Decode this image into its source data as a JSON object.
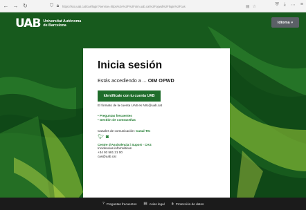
{
  "browser": {
    "back_icon": "arrow-left-icon",
    "forward_icon": "arrow-right-icon",
    "reload_icon": "reload-icon",
    "url": "https://sso.uab.cat/cas/login?service=https%3A%2F%2Foim.uab.cat%2Fopwd%2Flogin%2Fcas"
  },
  "header": {
    "logo_mark": "UAB",
    "university_line1": "Universitat Autònoma",
    "university_line2": "de Barcelona",
    "language_label": "Idioma"
  },
  "card": {
    "title": "Inicia sesión",
    "lead_prefix": "Estás accediendo a ... ",
    "lead_app": "OIM OPWD",
    "login_button": "Identifícate con tu cuenta UAB",
    "hint": "El formato de la cuenta UAB es NIU@uab.cat",
    "links": [
      "• Preguntas frecuentes",
      "• Gestión de contraseñas"
    ],
    "channels_prefix": "Canales de comunicación: ",
    "channels_link": "Canal TIC",
    "cas_label": "Centre d'Assistència i Suport - CAS",
    "info_lines": [
      "Incidencias informáticas",
      "+34 93 581 21 00",
      "cas@uab.cat"
    ]
  },
  "footer": {
    "items": [
      "Preguntas frecuentes",
      "Aviso legal",
      "Protección de datos"
    ]
  },
  "colors": {
    "accent": "#1f6d2b",
    "background": "#175a1d",
    "footer": "#1b1b1b"
  }
}
